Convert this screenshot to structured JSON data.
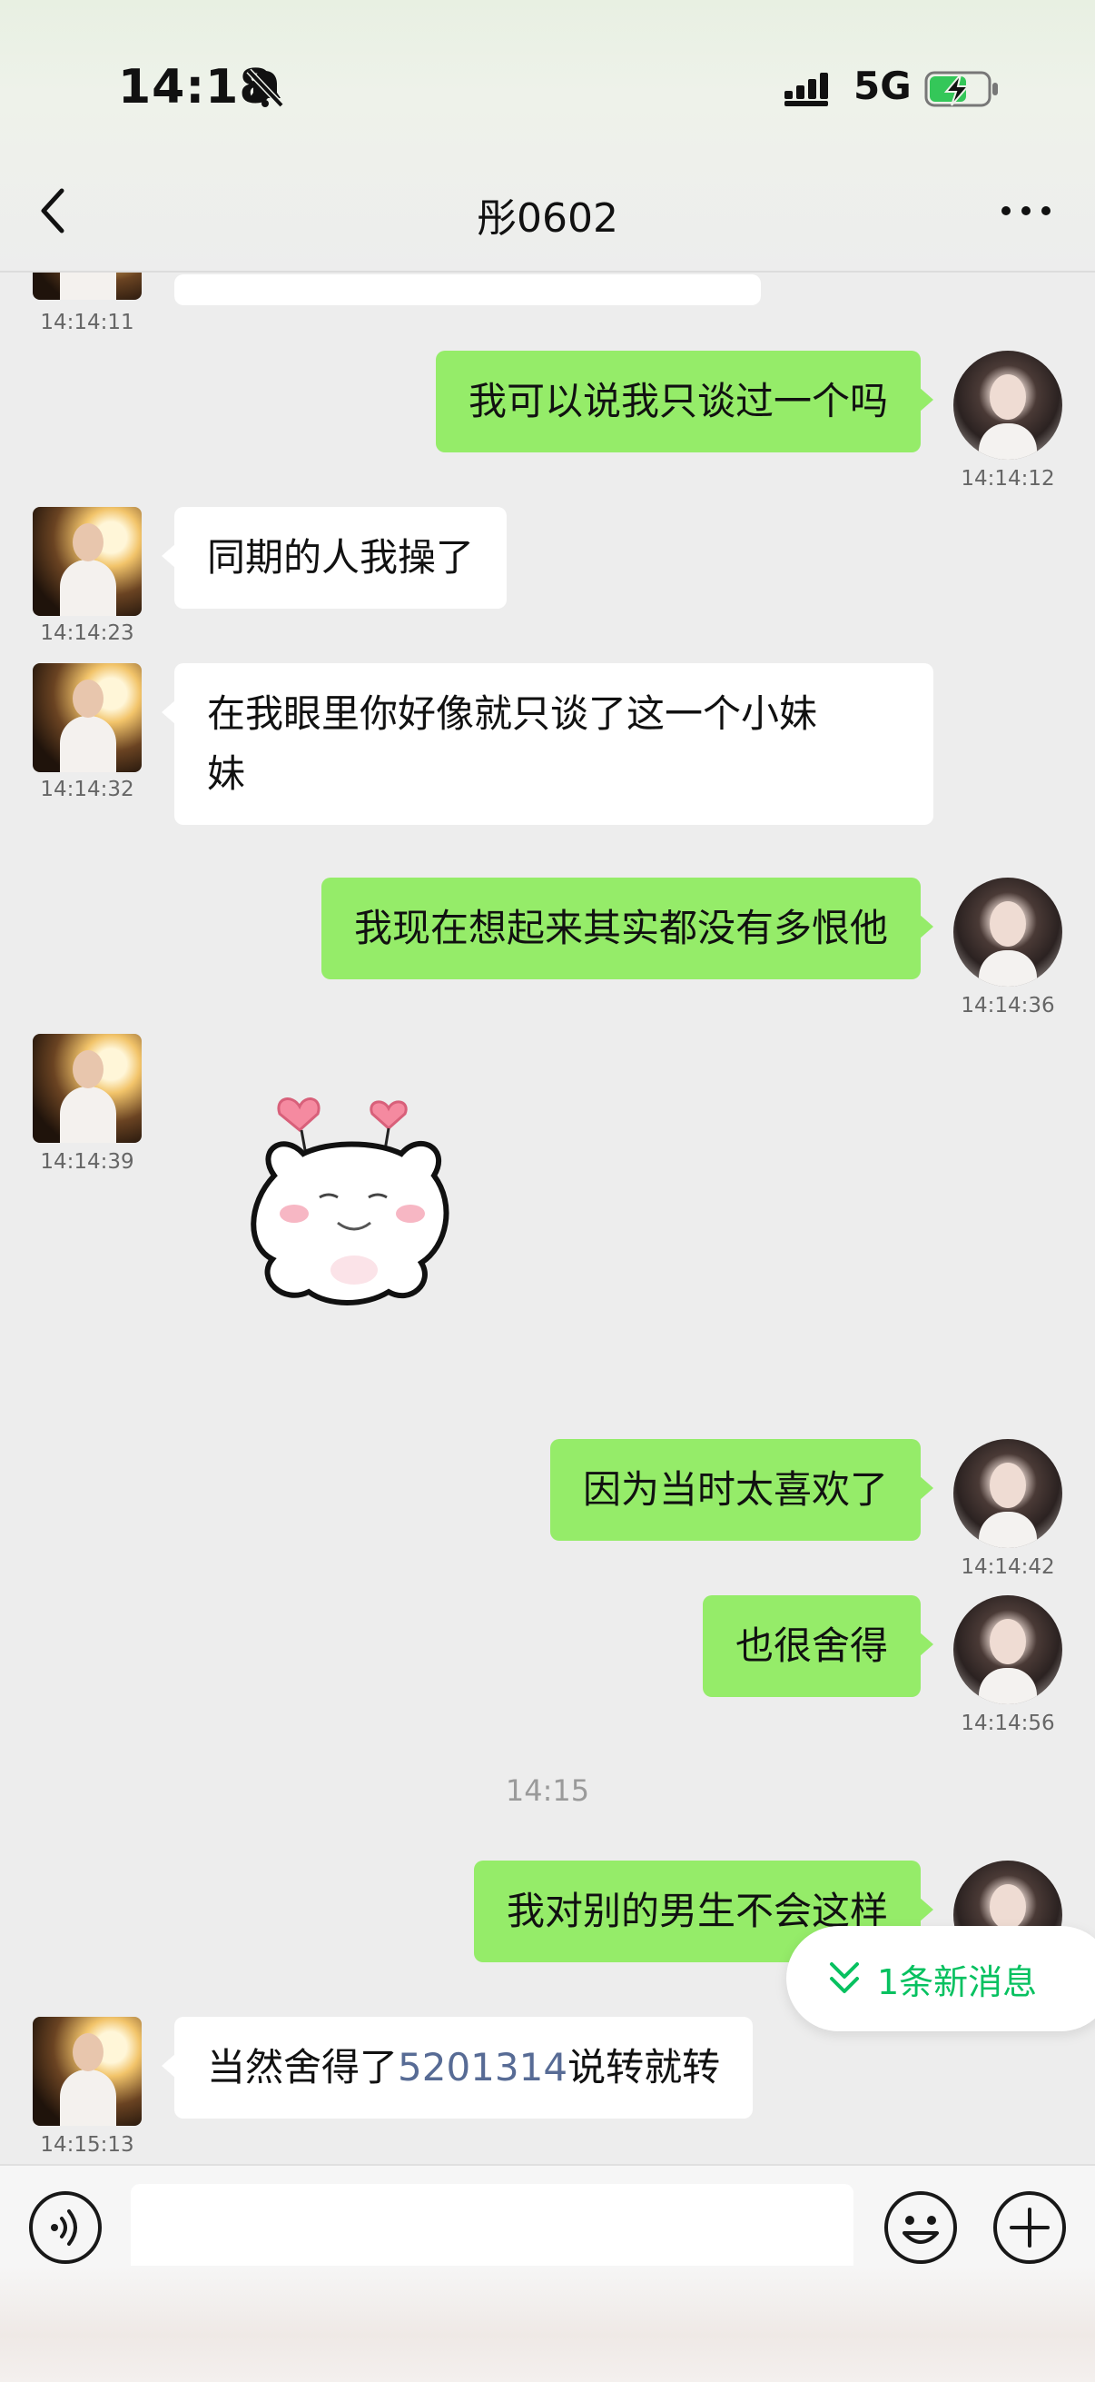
{
  "status_bar": {
    "time": "14:18",
    "network": "5G",
    "icons": [
      "bell-muted-icon",
      "signal-icon",
      "battery-charging-icon"
    ]
  },
  "nav": {
    "title": "彤0602",
    "back_icon": "chevron-left-icon",
    "more_icon": "ellipsis-icon"
  },
  "messages": [
    {
      "side": "other",
      "time": "14:14:11",
      "text": ""
    },
    {
      "side": "me",
      "time": "14:14:12",
      "text": "我可以说我只谈过一个吗"
    },
    {
      "side": "other",
      "time": "14:14:23",
      "text": "同期的人我操了"
    },
    {
      "side": "other",
      "time": "14:14:32",
      "text_line1": "在我眼里你好像就只谈了这一个小妹",
      "text_line2": "妹"
    },
    {
      "side": "me",
      "time": "14:14:36",
      "text": "我现在想起来其实都没有多恨他"
    },
    {
      "side": "other",
      "time": "14:14:39",
      "type": "sticker",
      "sticker": "bear-hearts-sticker"
    },
    {
      "side": "me",
      "time": "14:14:42",
      "text": "因为当时太喜欢了"
    },
    {
      "side": "me",
      "time": "14:14:56",
      "text": "也很舍得"
    },
    {
      "side": "me",
      "time": "",
      "text": "我对别的男生不会这样"
    },
    {
      "side": "other",
      "time": "14:15:13",
      "text_before": "当然舍得了",
      "link_number": "5201314",
      "text_after": "说转就转"
    }
  ],
  "time_divider": "14:15",
  "new_message_pill": {
    "label": "1条新消息",
    "icon": "double-chevron-down-icon"
  },
  "input_bar": {
    "placeholder": "",
    "icons": [
      "voice-icon",
      "emoji-icon",
      "plus-icon"
    ]
  },
  "colors": {
    "my_bubble": "#95ec69",
    "other_bubble": "#ffffff",
    "background": "#ededed",
    "link": "#576b95",
    "accent": "#07c160"
  }
}
